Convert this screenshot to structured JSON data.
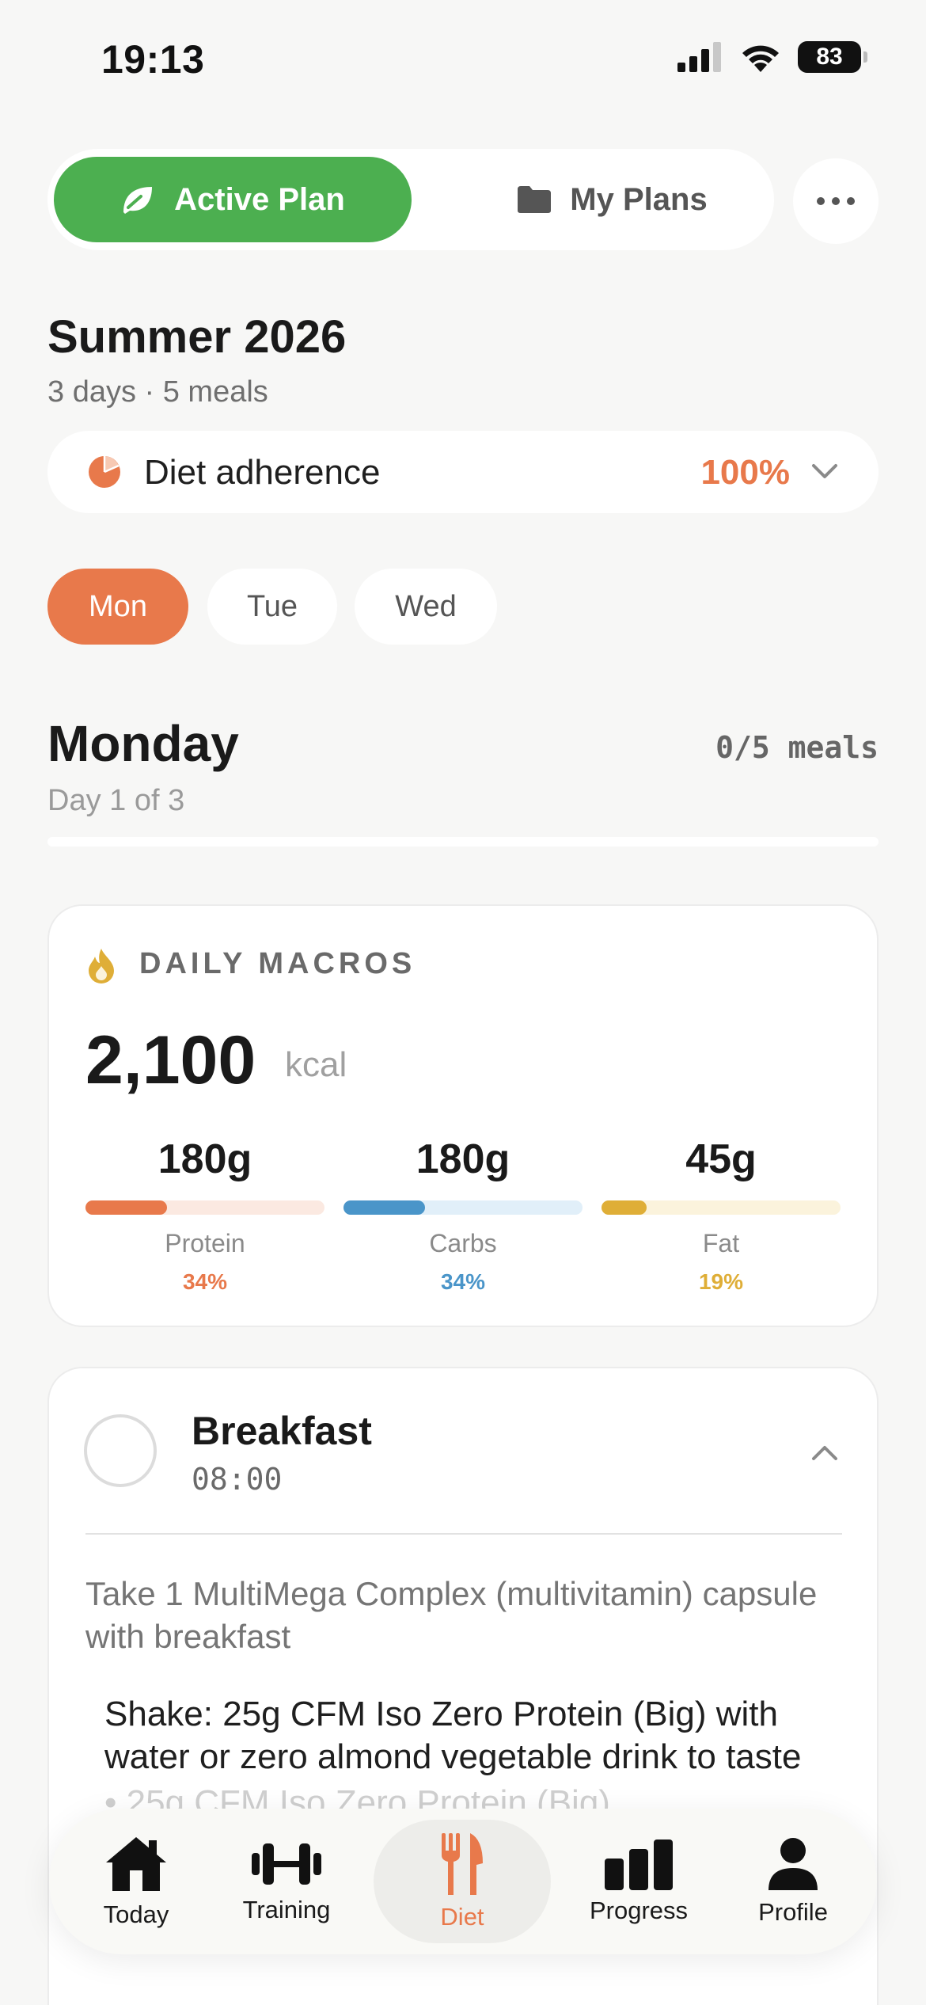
{
  "status_bar": {
    "time": "19:13",
    "battery": "83"
  },
  "header": {
    "active_tab_label": "Active Plan",
    "plans_tab_label": "My Plans"
  },
  "plan": {
    "title": "Summer 2026",
    "subtitle": "3 days · 5 meals",
    "adherence_label": "Diet adherence",
    "adherence_value": "100%"
  },
  "days": [
    {
      "label": "Mon",
      "selected": true
    },
    {
      "label": "Tue",
      "selected": false
    },
    {
      "label": "Wed",
      "selected": false
    }
  ],
  "day": {
    "title": "Monday",
    "subtitle": "Day 1 of 3",
    "meals_done": "0/5 meals",
    "progress": 0
  },
  "macros": {
    "title": "DAILY MACROS",
    "kcal_value": "2,100",
    "kcal_unit": "kcal",
    "items": [
      {
        "grams": "180g",
        "name": "Protein",
        "percent_label": "34%",
        "percent": 34,
        "color": "#e8794b",
        "track": "#fbe9e1"
      },
      {
        "grams": "180g",
        "name": "Carbs",
        "percent_label": "34%",
        "percent": 34,
        "color": "#4a95c9",
        "track": "#e1eff9"
      },
      {
        "grams": "45g",
        "name": "Fat",
        "percent_label": "19%",
        "percent": 19,
        "color": "#dfae37",
        "track": "#fbf3dc"
      }
    ]
  },
  "meal": {
    "name": "Breakfast",
    "time": "08:00",
    "note": "Take 1 MultiMega Complex (multivitamin) capsule with breakfast",
    "item": "Shake: 25g CFM Iso Zero Protein (Big) with water or zero almond vegetable drink to taste",
    "item_next": "• 25g CFM Iso Zero Protein (Big)"
  },
  "tab_bar": {
    "items": [
      {
        "label": "Today",
        "icon": "home-icon"
      },
      {
        "label": "Training",
        "icon": "dumbbell-icon"
      },
      {
        "label": "Diet",
        "icon": "fork-knife-icon",
        "active": true
      },
      {
        "label": "Progress",
        "icon": "bar-chart-icon"
      },
      {
        "label": "Profile",
        "icon": "person-icon"
      }
    ]
  },
  "colors": {
    "accent": "#e8794b",
    "green": "#4caf50",
    "background": "#f7f7f6"
  }
}
